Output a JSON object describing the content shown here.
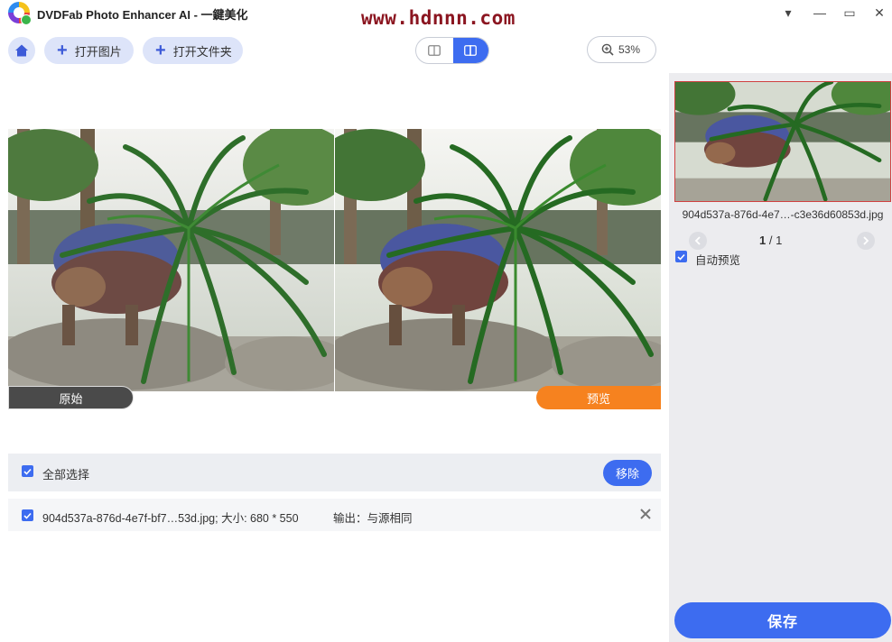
{
  "window": {
    "title": "DVDFab Photo Enhancer AI - 一鍵美化",
    "watermark": "www.hdnnn.com",
    "controls": {
      "dropdown": "▾",
      "minimize": "—",
      "maximize": "▭",
      "close": "✕"
    }
  },
  "toolbar": {
    "home_icon": "home-icon",
    "open_image_label": "打开图片",
    "open_folder_label": "打开文件夹",
    "view_modes": [
      "single",
      "split"
    ],
    "active_view": "split",
    "zoom": "53%"
  },
  "preview": {
    "original_label": "原始",
    "preview_label": "预览"
  },
  "file_list": {
    "select_all_label": "全部选择",
    "remove_label": "移除",
    "files": [
      {
        "name_info": "904d537a-876d-4e7f-bf7…53d.jpg; 大小: 680 * 550",
        "output_info": "输出：与源相同",
        "checked": true
      }
    ]
  },
  "side_panel": {
    "thumbnail_name": "904d537a-876d-4e7…-c3e36d60853d.jpg",
    "pager": {
      "current": "1",
      "separator": " / ",
      "total": "1"
    },
    "auto_preview_label": "自动预览",
    "save_label": "保存"
  },
  "colors": {
    "accent": "#3d6cf0",
    "preview_tag": "#f6821f",
    "original_tag": "#4a4a4a",
    "watermark": "#8b1520"
  }
}
